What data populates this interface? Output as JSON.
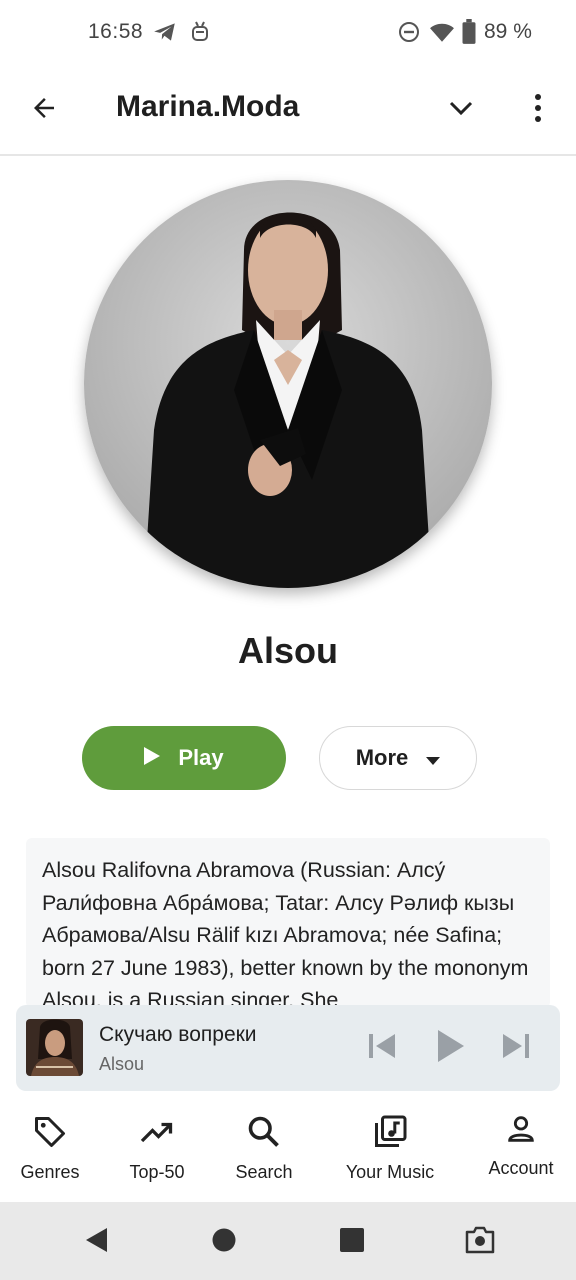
{
  "status_bar": {
    "time": "16:58",
    "battery": "89 %",
    "icons": [
      "telegram-icon",
      "android-debug-icon",
      "do-not-disturb-icon",
      "wifi-icon",
      "battery-icon"
    ]
  },
  "app_bar": {
    "title": "Marina.Moda",
    "icons": [
      "back-arrow-icon",
      "chevron-down-icon",
      "more-vert-icon"
    ]
  },
  "artist": {
    "name": "Alsou",
    "play_label": "Play",
    "more_label": "More",
    "bio": "Alsou Ralifovna Abramova (Russian: Алсу́ Рали́фовна Абра́мова; Tatar: Алсу Рәлиф кызы Абрамова/Alsu Rälif kızı Abramova; née Safina; born 27 June 1983), better known by the mononym Alsou, is a Russian singer. She"
  },
  "mini_player": {
    "title": "Скучаю вопреки",
    "artist": "Alsou",
    "icons": [
      "skip-previous-icon",
      "play-icon",
      "skip-next-icon"
    ]
  },
  "bottom_nav": {
    "items": [
      {
        "label": "Genres",
        "icon": "tag-icon"
      },
      {
        "label": "Top-50",
        "icon": "trending-up-icon"
      },
      {
        "label": "Search",
        "icon": "search-icon"
      },
      {
        "label": "Your Music",
        "icon": "library-music-icon"
      },
      {
        "label": "Account",
        "icon": "person-icon"
      }
    ]
  },
  "system_nav": {
    "icons": [
      "back-triangle-icon",
      "home-circle-icon",
      "recents-square-icon",
      "screenshot-camera-icon"
    ]
  },
  "colors": {
    "accent_green": "#5f9c3c",
    "mini_player_bg": "#e7ecef",
    "bio_bg": "#f6f7f8",
    "system_nav_bg": "#e9e9e9"
  }
}
